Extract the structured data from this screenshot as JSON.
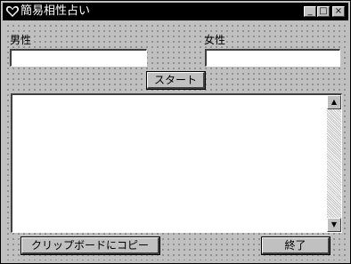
{
  "window": {
    "title": "簡易相性占い",
    "buttons": {
      "minimize": "_",
      "maximize": "□",
      "close": "×"
    }
  },
  "form": {
    "male_label": "男性",
    "female_label": "女性",
    "male_value": "",
    "female_value": "",
    "start_label": "スタート"
  },
  "result": {
    "text": ""
  },
  "footer": {
    "copy_label": "クリップボードにコピー",
    "exit_label": "終了"
  },
  "icons": {
    "app": "heart-icon",
    "scroll_up": "▲",
    "scroll_down": "▼"
  }
}
